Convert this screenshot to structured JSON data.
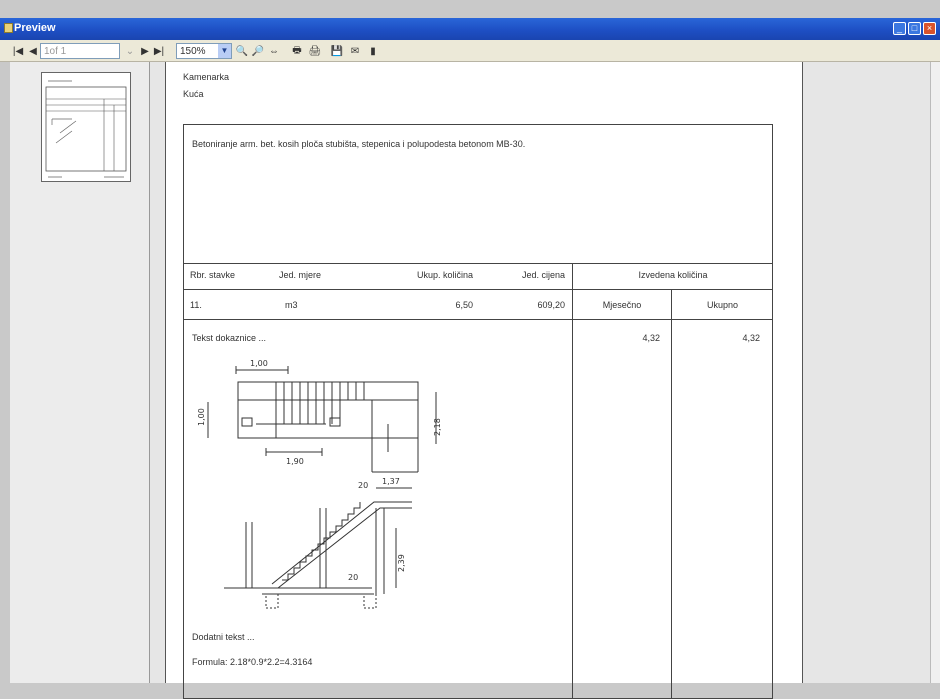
{
  "window": {
    "title": "Preview"
  },
  "toolbar": {
    "page_indicator": "1of 1",
    "zoom": "150%"
  },
  "document": {
    "header_line1": "Kamenarka",
    "header_line2": "Kuća",
    "description": "Betoniranje arm. bet. kosih ploča stubišta, stepenica i polupodesta betonom MB-30.",
    "columns": {
      "item_no": "Rbr. stavke",
      "unit": "Jed. mjere",
      "total_qty": "Ukup. količina",
      "unit_price": "Jed. cijena",
      "executed_qty": "Izvedena količina",
      "monthly": "Mjesečno",
      "cumulative": "Ukupno"
    },
    "row": {
      "item_no": "11.",
      "unit": "m3",
      "total_qty": "6,50",
      "unit_price": "609,20",
      "monthly": "4,32",
      "cumulative": "4,32"
    },
    "proof_text": "Tekst dokaznice ...",
    "additional_text": "Dodatni tekst ...",
    "formula": "Formula: 2.18*0.9*2.2=4.3164",
    "drawing_dims": {
      "d1": "1,00",
      "d2": "1,00",
      "d3": "1,90",
      "d4": "2,18",
      "d5": "20",
      "d6": "1,37",
      "d7": "2,39",
      "d8": "20"
    }
  }
}
